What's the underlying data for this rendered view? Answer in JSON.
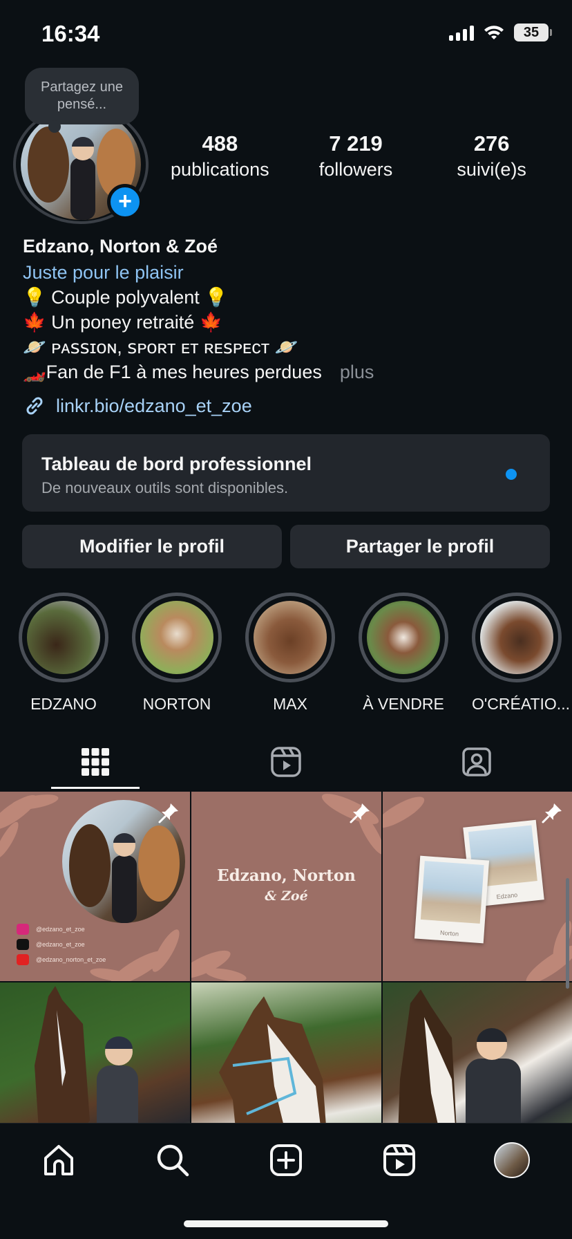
{
  "status_bar": {
    "time": "16:34",
    "battery": "35"
  },
  "profile": {
    "note": "Partagez une pensé...",
    "stats": [
      {
        "value": "488",
        "label": "publications"
      },
      {
        "value": "7 219",
        "label": "followers"
      },
      {
        "value": "276",
        "label": "suivi(e)s"
      }
    ],
    "name": "Edzano, Norton & Zoé",
    "category": "Juste pour le plaisir",
    "bio_lines": [
      "💡 Couple polyvalent 💡",
      "🍁 Un poney retraité 🍁",
      "🪐 ᴘᴀꜱꜱɪᴏɴ, ꜱᴘᴏʀᴛ ᴇᴛ ʀᴇꜱᴘᴇᴄᴛ 🪐",
      "🏎️Fan de F1 à mes heures perdues"
    ],
    "more": "plus",
    "link": "linkr.bio/edzano_et_zoe"
  },
  "pro_dashboard": {
    "title": "Tableau de bord professionnel",
    "subtitle": "De nouveaux outils sont disponibles."
  },
  "buttons": {
    "edit": "Modifier le profil",
    "share": "Partager le profil"
  },
  "highlights": [
    {
      "label": "EDZANO",
      "color": "#5a6b3c"
    },
    {
      "label": "NORTON",
      "color": "#8fae5a"
    },
    {
      "label": "MAX",
      "color": "#8a5a3c"
    },
    {
      "label": "À VENDRE",
      "color": "#6a8a4a"
    },
    {
      "label": "O'CRÉATIO...",
      "color": "#c9d6dc"
    }
  ],
  "tabs": [
    {
      "name": "grid",
      "icon": "grid-icon",
      "active": true
    },
    {
      "name": "reels",
      "icon": "reels-icon",
      "active": false
    },
    {
      "name": "tagged",
      "icon": "tagged-icon",
      "active": false
    }
  ],
  "posts": {
    "post1_socials": [
      "@edzano_et_zoe",
      "@edzano_et_zoe",
      "@edzano_norton_et_zoe"
    ],
    "post2_title": "Edzano, Norton",
    "post2_subtitle": "& Zoé",
    "post3_captions": [
      "Edzano",
      "Norton"
    ]
  },
  "bottom_nav": [
    "home-icon",
    "search-icon",
    "create-icon",
    "reels-icon",
    "profile-avatar"
  ],
  "colors": {
    "background": "#0b1014",
    "accent": "#0d93f2",
    "link": "#a8d2f7",
    "post_brown": "#9c6f66"
  }
}
